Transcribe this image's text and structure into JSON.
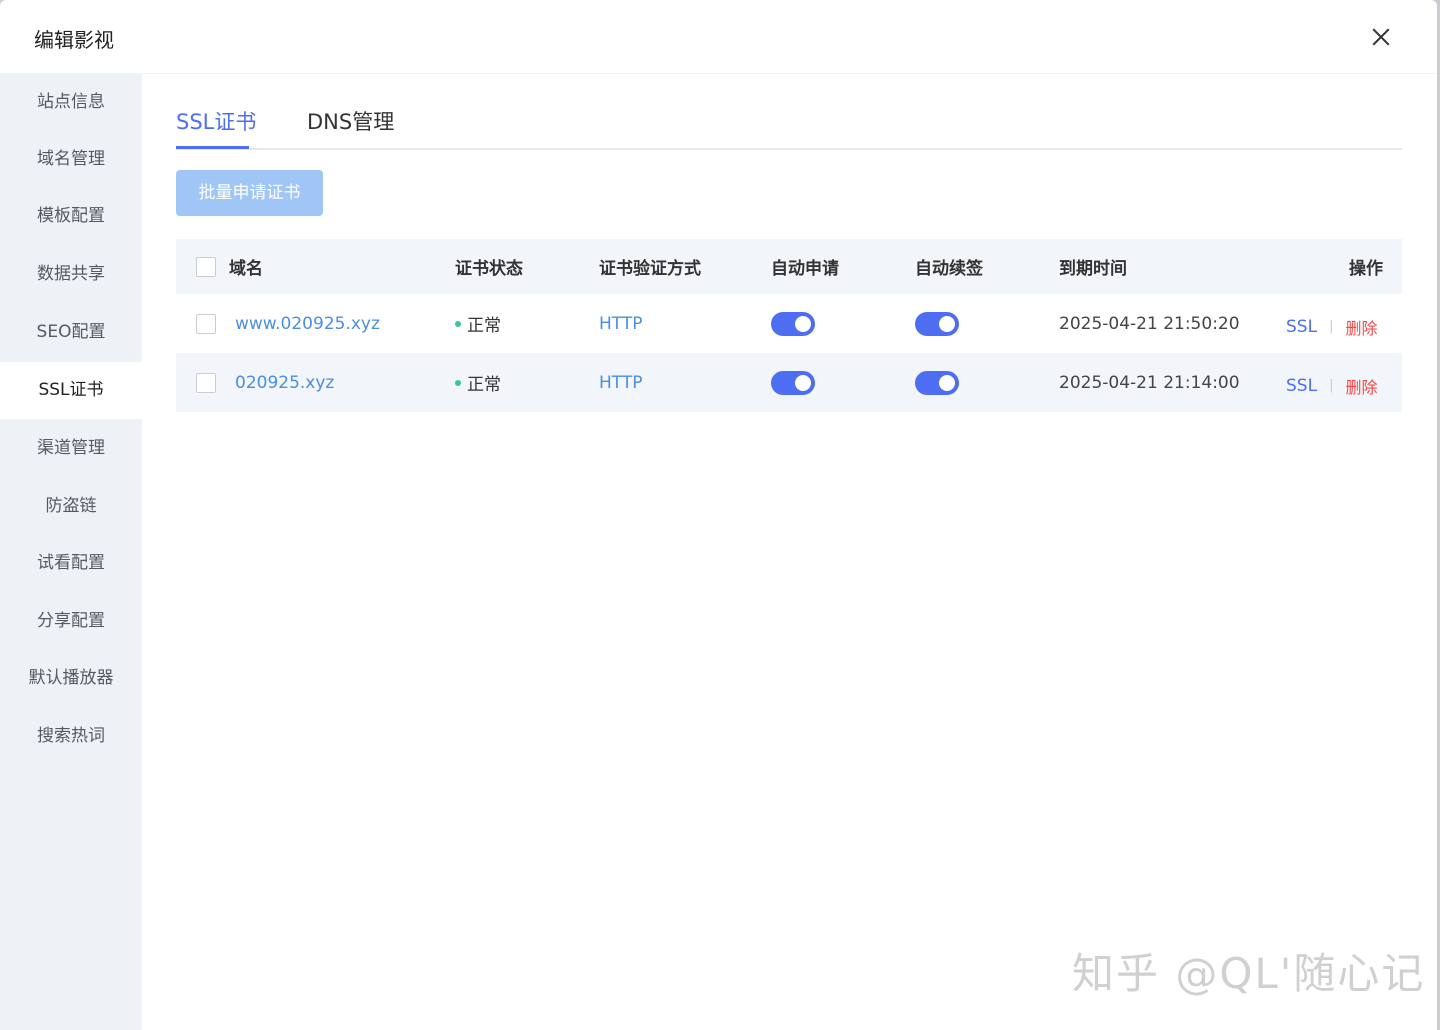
{
  "window": {
    "title": "编辑影视"
  },
  "sidebar": {
    "items": [
      {
        "label": "站点信息",
        "active": false
      },
      {
        "label": "域名管理",
        "active": false
      },
      {
        "label": "模板配置",
        "active": false
      },
      {
        "label": "数据共享",
        "active": false
      },
      {
        "label": "SEO配置",
        "active": false
      },
      {
        "label": "SSL证书",
        "active": true
      },
      {
        "label": "渠道管理",
        "active": false
      },
      {
        "label": "防盗链",
        "active": false
      },
      {
        "label": "试看配置",
        "active": false
      },
      {
        "label": "分享配置",
        "active": false
      },
      {
        "label": "默认播放器",
        "active": false
      },
      {
        "label": "搜索热词",
        "active": false
      }
    ]
  },
  "tabs": [
    {
      "label": "SSL证书",
      "active": true
    },
    {
      "label": "DNS管理",
      "active": false
    }
  ],
  "toolbar": {
    "batch_label": "批量申请证书"
  },
  "table": {
    "headers": {
      "domain": "域名",
      "status": "证书状态",
      "method": "证书验证方式",
      "auto_apply": "自动申请",
      "auto_renew": "自动续签",
      "expiry": "到期时间",
      "actions": "操作"
    },
    "rows": [
      {
        "domain": "www.020925.xyz",
        "status": "正常",
        "method": "HTTP",
        "auto_apply": true,
        "auto_renew": true,
        "expiry": "2025-04-21 21:50:20",
        "ssl": "SSL",
        "sep": "|",
        "delete": "删除"
      },
      {
        "domain": "020925.xyz",
        "status": "正常",
        "method": "HTTP",
        "auto_apply": true,
        "auto_renew": true,
        "expiry": "2025-04-21 21:14:00",
        "ssl": "SSL",
        "sep": "|",
        "delete": "删除"
      }
    ]
  },
  "colors": {
    "accent": "#4e6ef2",
    "link": "#4a8fe0",
    "status_ok": "#3cc59a",
    "danger": "#f0484a"
  },
  "watermark": "知乎 @QL'随心记"
}
